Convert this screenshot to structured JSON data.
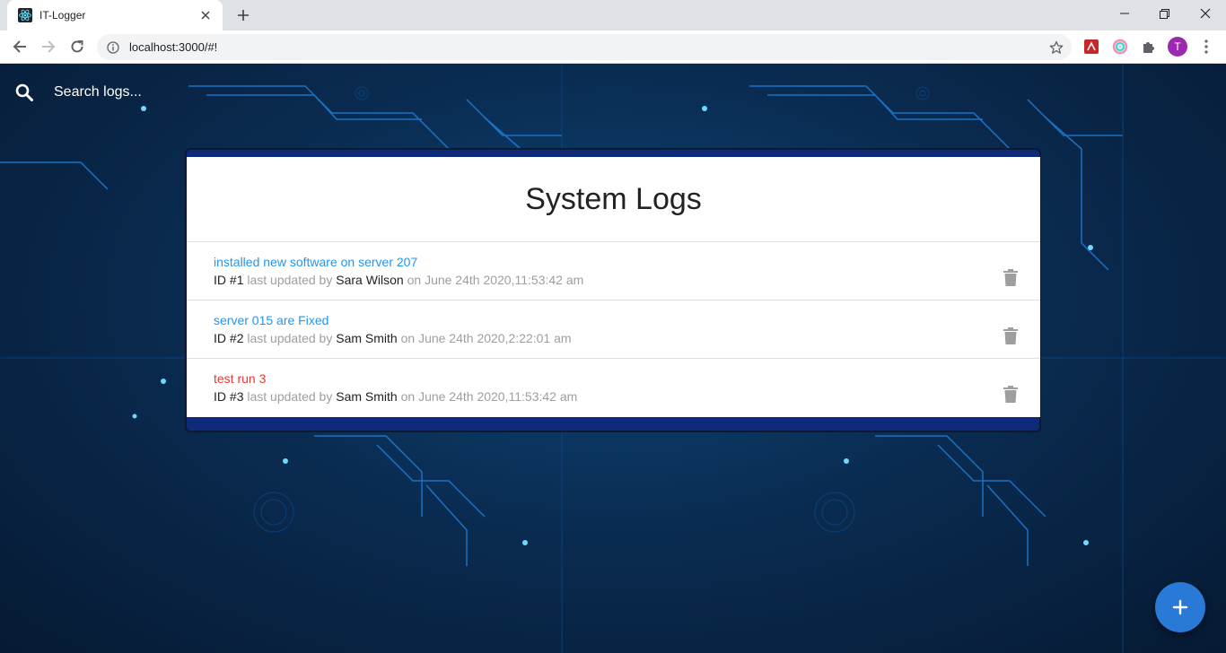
{
  "browser": {
    "tab_title": "IT-Logger",
    "url": "localhost:3000/#!",
    "profile_initial": "T"
  },
  "search": {
    "placeholder": "Search logs..."
  },
  "panel": {
    "title": "System Logs",
    "id_prefix": "ID #",
    "updated_label": "last updated by",
    "on_label": "on"
  },
  "logs": [
    {
      "message": "installed new software on server 207",
      "id": "1",
      "tech": "Sara Wilson",
      "date": "June 24th 2020,11:53:42 am",
      "attention": false
    },
    {
      "message": "server 015 are Fixed",
      "id": "2",
      "tech": "Sam Smith",
      "date": "June 24th 2020,2:22:01 am",
      "attention": false
    },
    {
      "message": "test run 3",
      "id": "3",
      "tech": "Sam Smith",
      "date": "June 24th 2020,11:53:42 am",
      "attention": true
    }
  ],
  "colors": {
    "link": "#2196f3",
    "attention": "#e53935",
    "fab": "#2979d6",
    "panel_frame": "#0d2b7a"
  },
  "icons": {
    "search": "search-icon",
    "delete": "delete-icon",
    "add": "add-icon"
  }
}
